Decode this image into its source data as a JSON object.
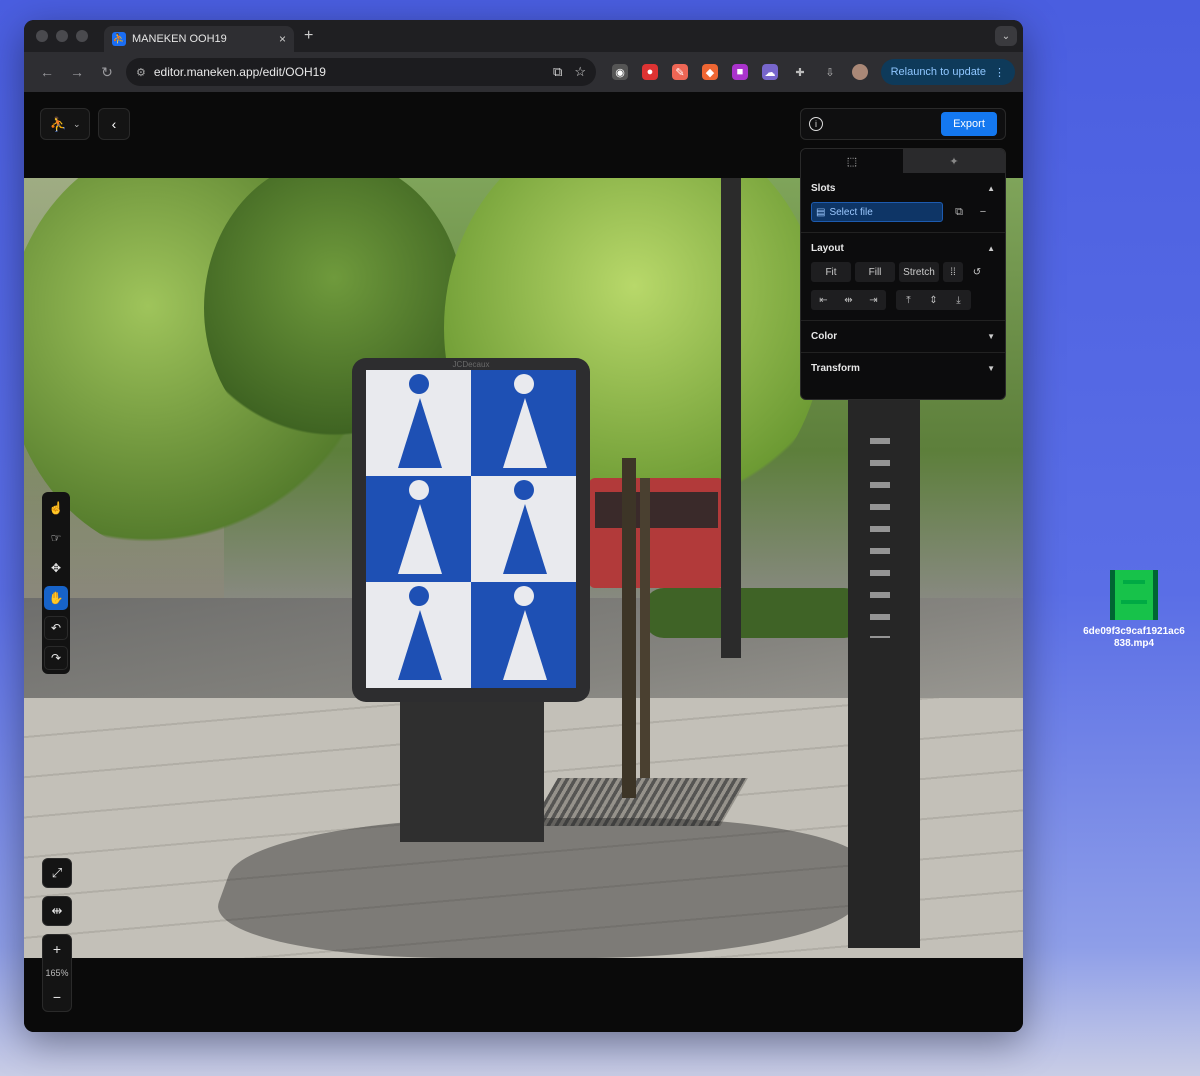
{
  "browser": {
    "tab_title": "MANEKEN OOH19",
    "tab_close": "×",
    "new_tab": "+",
    "url": "editor.maneken.app/edit/OOH19",
    "relaunch_label": "Relaunch to update",
    "relaunch_color": "#8fc6ff",
    "nav_back_icon": "arrow-left-icon",
    "nav_forward_icon": "arrow-right-icon",
    "reload_icon": "reload-icon"
  },
  "editor": {
    "export_label": "Export",
    "accent_color": "#1478f0",
    "billboard_brand": "JCDecaux"
  },
  "panel": {
    "slots": {
      "title": "Slots",
      "select_file": "Select file"
    },
    "layout": {
      "title": "Layout",
      "fit": "Fit",
      "fill": "Fill",
      "stretch": "Stretch"
    },
    "color": {
      "title": "Color"
    },
    "transform": {
      "title": "Transform"
    }
  },
  "zoom": {
    "level": "165%",
    "plus": "+",
    "minus": "−"
  },
  "desktop": {
    "file_name": "6de09f3c9caf1921ac6838.mp4"
  }
}
